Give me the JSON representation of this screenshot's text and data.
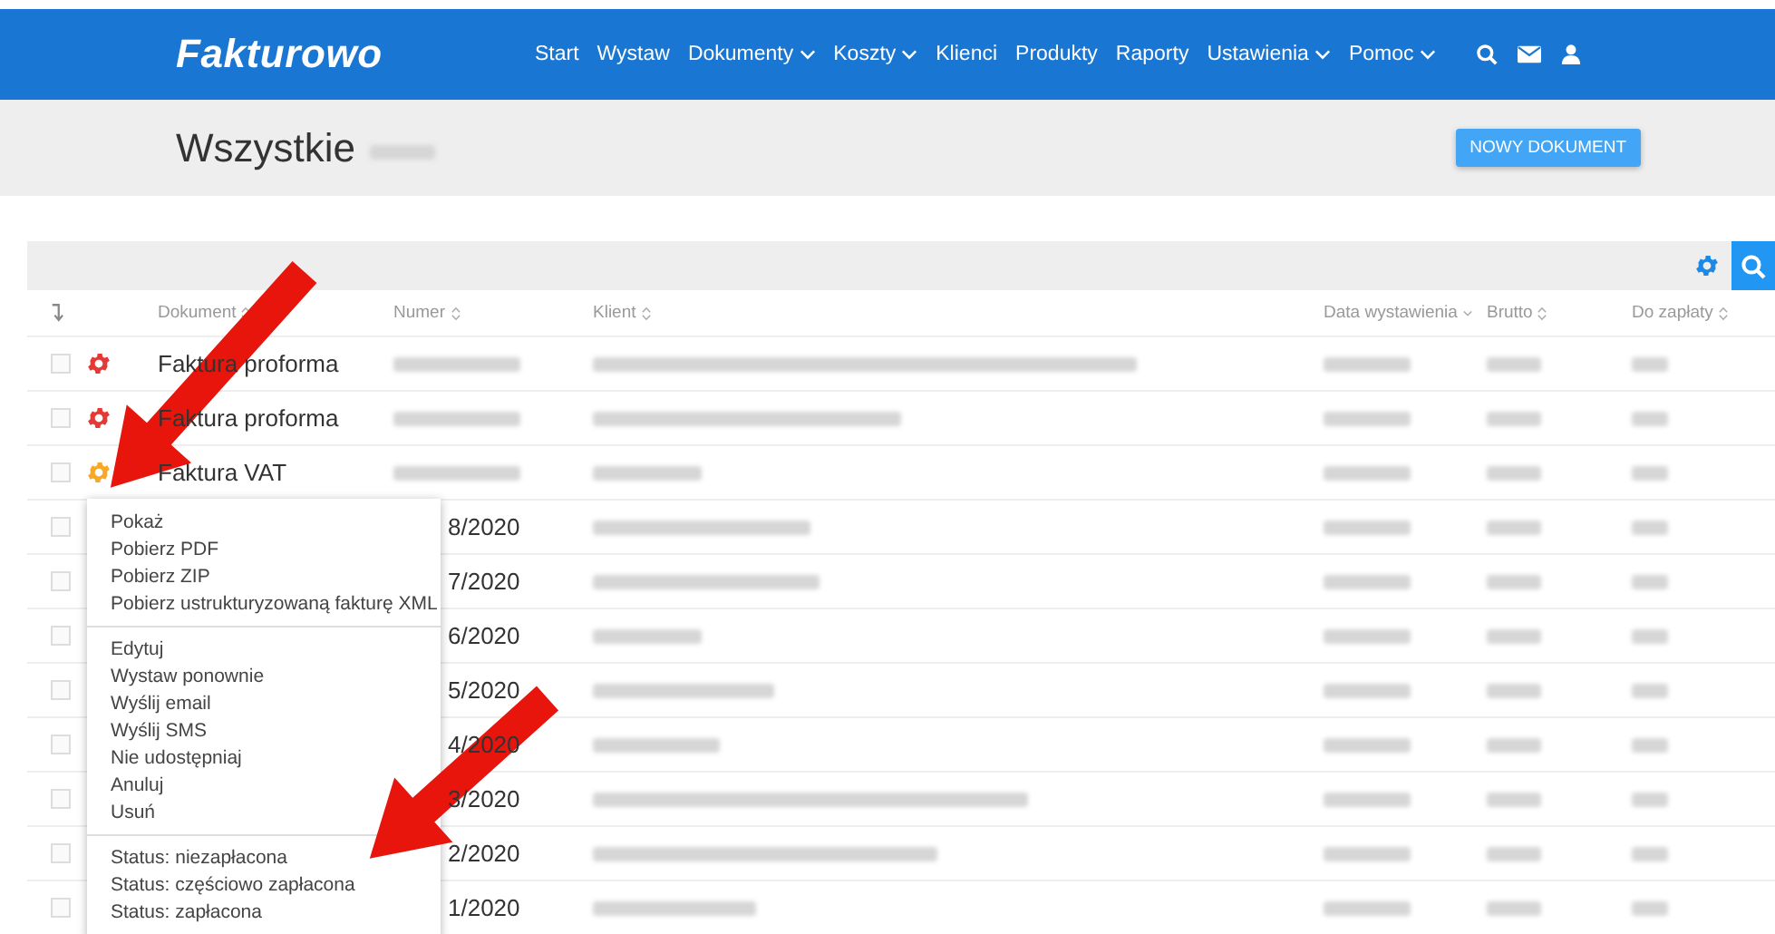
{
  "brand": {
    "logo": "Fakturowo"
  },
  "nav": [
    {
      "label": "Start",
      "dropdown": false
    },
    {
      "label": "Wystaw",
      "dropdown": false
    },
    {
      "label": "Dokumenty",
      "dropdown": true
    },
    {
      "label": "Koszty",
      "dropdown": true
    },
    {
      "label": "Klienci",
      "dropdown": false
    },
    {
      "label": "Produkty",
      "dropdown": false
    },
    {
      "label": "Raporty",
      "dropdown": false
    },
    {
      "label": "Ustawienia",
      "dropdown": true
    },
    {
      "label": "Pomoc",
      "dropdown": true
    }
  ],
  "page": {
    "title": "Wszystkie",
    "button": "NOWY DOKUMENT"
  },
  "table": {
    "columns": [
      {
        "label": "Dokument",
        "sorted": false
      },
      {
        "label": "Numer",
        "sorted": false
      },
      {
        "label": "Klient",
        "sorted": false
      },
      {
        "label": "Data wystawienia",
        "sorted": true
      },
      {
        "label": "Brutto",
        "sorted": false
      },
      {
        "label": "Do zapłaty",
        "sorted": false
      }
    ],
    "rows": [
      {
        "checked": false,
        "color": "#e53935",
        "document": "Faktura proforma"
      },
      {
        "checked": false,
        "color": "#e53935",
        "document": "Faktura proforma"
      },
      {
        "checked": false,
        "color": "#f9a825",
        "document": "Faktura VAT"
      },
      {
        "checked": false,
        "number": "8/2020"
      },
      {
        "checked": false,
        "number": "7/2020"
      },
      {
        "checked": false,
        "number": "6/2020"
      },
      {
        "checked": false,
        "number": "5/2020"
      },
      {
        "checked": false,
        "number": "4/2020"
      },
      {
        "checked": false,
        "number": "3/2020"
      },
      {
        "checked": false,
        "number": "2/2020"
      },
      {
        "checked": false,
        "number": "1/2020"
      }
    ]
  },
  "context_menu": {
    "groups": [
      [
        "Pokaż",
        "Pobierz PDF",
        "Pobierz ZIP",
        "Pobierz ustrukturyzowaną fakturę XML"
      ],
      [
        "Edytuj",
        "Wystaw ponownie",
        "Wyślij email",
        "Wyślij SMS",
        "Nie udostępniaj",
        "Anuluj",
        "Usuń"
      ],
      [
        "Status: niezapłacona",
        "Status: częściowo zapłacona",
        "Status: zapłacona"
      ]
    ]
  }
}
